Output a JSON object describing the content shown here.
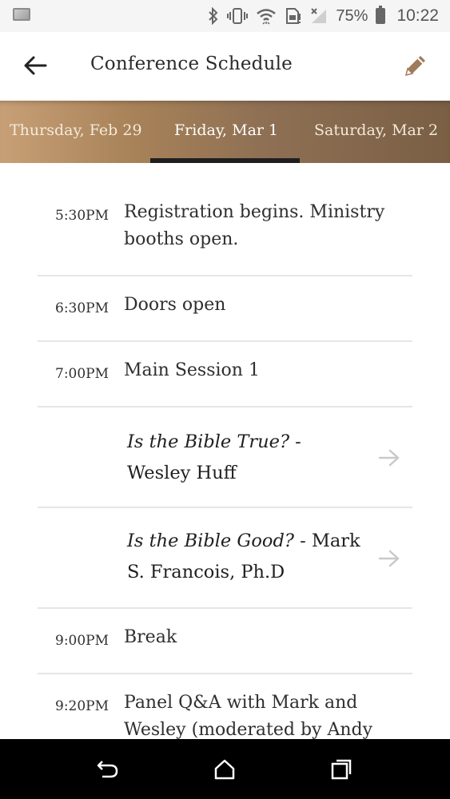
{
  "status_bar": {
    "battery_percent": "75%",
    "time": "10:22",
    "icons": [
      "gallery-icon",
      "bluetooth-icon",
      "vibrate-icon",
      "wifi-icon",
      "sim-icon",
      "signal-icon",
      "battery-icon"
    ]
  },
  "header": {
    "title": "Conference Schedule",
    "back_icon": "arrow-left-icon",
    "edit_icon": "pencil-icon"
  },
  "tabs": {
    "items": [
      {
        "label": "Thursday, Feb 29"
      },
      {
        "label": "Friday, Mar 1"
      },
      {
        "label": "Saturday, Mar 2"
      }
    ],
    "selected_index": 1
  },
  "schedule": {
    "items": [
      {
        "time": "5:30PM",
        "description": "Registration begins. Ministry booths open."
      },
      {
        "time": "6:30PM",
        "description": "Doors open"
      },
      {
        "time": "7:00PM",
        "description": "Main Session 1"
      },
      {
        "talk_title": "Is the Bible True?",
        "talk_rest": " - Wesley Huff"
      },
      {
        "talk_title": "Is the Bible Good?",
        "talk_rest": " - Mark S. Francois, Ph.D"
      },
      {
        "time": "9:00PM",
        "description": "Break"
      },
      {
        "time": "9:20PM",
        "description": "Panel Q&A with Mark and Wesley (moderated by Andy"
      }
    ]
  },
  "colors": {
    "tab_gradient_start": "#c8a077",
    "tab_gradient_end": "#7a5f45",
    "indicator": "#1f1f1f",
    "divider": "#e6e6e6"
  }
}
